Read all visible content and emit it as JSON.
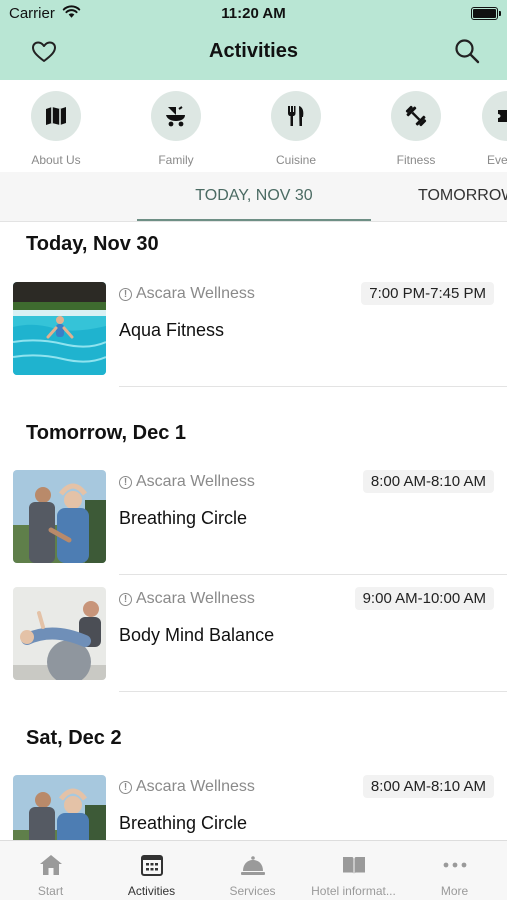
{
  "status_bar": {
    "carrier": "Carrier",
    "time": "11:20 AM"
  },
  "header": {
    "title": "Activities",
    "heart_icon": "heart-icon",
    "search_icon": "search-icon"
  },
  "categories": [
    {
      "label": "About Us",
      "icon": "map-icon"
    },
    {
      "label": "Family",
      "icon": "stroller-icon"
    },
    {
      "label": "Cuisine",
      "icon": "fork-knife-icon"
    },
    {
      "label": "Fitness",
      "icon": "dumbbell-icon"
    },
    {
      "label": "Eve",
      "icon": "ticket-icon"
    }
  ],
  "date_tabs": {
    "active": "TODAY, NOV 30",
    "next": "TOMORROW"
  },
  "sections": [
    {
      "heading": "Today, Nov 30",
      "items": [
        {
          "venue": "Ascara Wellness",
          "time": "7:00 PM-7:45 PM",
          "name": "Aqua Fitness",
          "image": "pool-photo"
        }
      ]
    },
    {
      "heading": "Tomorrow, Dec 1",
      "items": [
        {
          "venue": "Ascara Wellness",
          "time": "8:00 AM-8:10 AM",
          "name": "Breathing Circle",
          "image": "stretch-photo"
        },
        {
          "venue": "Ascara Wellness",
          "time": "9:00 AM-10:00 AM",
          "name": "Body Mind Balance",
          "image": "ball-photo"
        }
      ]
    },
    {
      "heading": "Sat, Dec 2",
      "items": [
        {
          "venue": "Ascara Wellness",
          "time": "8:00 AM-8:10 AM",
          "name": "Breathing Circle",
          "image": "stretch-photo"
        }
      ]
    }
  ],
  "tab_bar": [
    {
      "label": "Start",
      "icon": "home-icon",
      "active": false
    },
    {
      "label": "Activities",
      "icon": "calendar-icon",
      "active": true
    },
    {
      "label": "Services",
      "icon": "service-bell-icon",
      "active": false
    },
    {
      "label": "Hotel informat...",
      "icon": "book-icon",
      "active": false
    },
    {
      "label": "More",
      "icon": "more-dots-icon",
      "active": false
    }
  ],
  "colors": {
    "header_bg": "#b9e6d4",
    "accent": "#6e8f85",
    "chip_bg": "#dde7e3"
  }
}
